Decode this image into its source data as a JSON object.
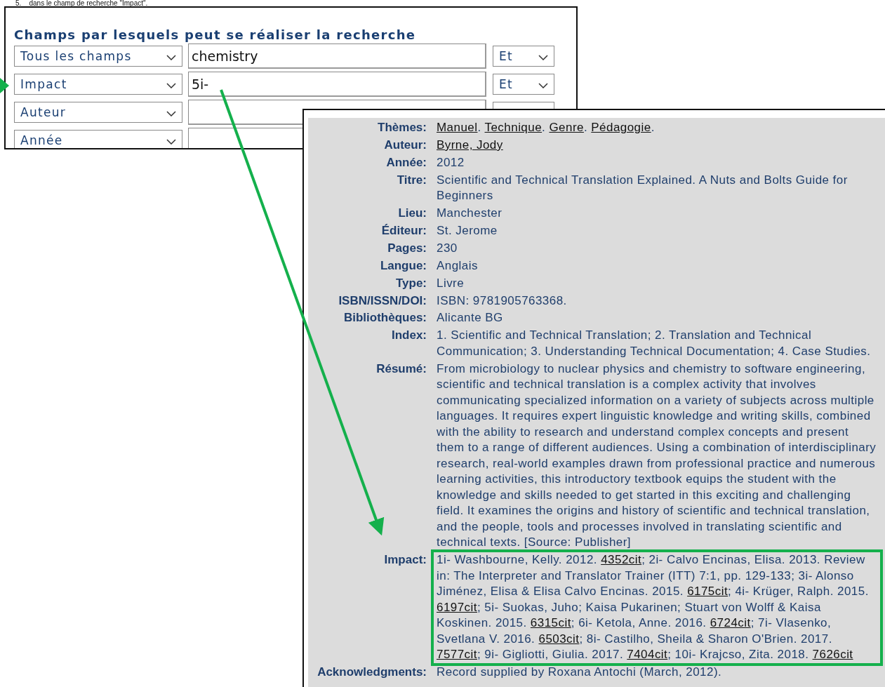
{
  "note": "5.    dans le champ de recherche \"Impact\".",
  "search_panel": {
    "title": "Champs par lesquels peut se réaliser la recherche",
    "rows": [
      {
        "field": "Tous les champs",
        "term": "chemistry",
        "operator": "Et",
        "kind": "full"
      },
      {
        "field": "Impact",
        "term": "5i-",
        "operator": "Et",
        "kind": "full"
      },
      {
        "field": "Auteur",
        "kind": "full"
      },
      {
        "field": "Année",
        "kind": "partial"
      }
    ]
  },
  "record": {
    "fields": [
      {
        "label": "Thèmes:",
        "highlighted": false,
        "segments": [
          {
            "text": "Manuel",
            "kind": "link"
          },
          {
            "text": ". ",
            "kind": "text"
          },
          {
            "text": "Technique",
            "kind": "link"
          },
          {
            "text": ". ",
            "kind": "text"
          },
          {
            "text": "Genre",
            "kind": "link"
          },
          {
            "text": ". ",
            "kind": "text"
          },
          {
            "text": "Pédagogie",
            "kind": "link"
          },
          {
            "text": ".",
            "kind": "text"
          }
        ]
      },
      {
        "label": "Auteur:",
        "highlighted": false,
        "segments": [
          {
            "text": "Byrne, Jody",
            "kind": "link"
          }
        ]
      },
      {
        "label": "Année:",
        "highlighted": false,
        "value": "2012"
      },
      {
        "label": "Titre:",
        "highlighted": false,
        "value": "Scientific and Technical Translation Explained. A Nuts and Bolts Guide for Beginners"
      },
      {
        "label": "Lieu:",
        "highlighted": false,
        "value": "Manchester"
      },
      {
        "label": "Éditeur:",
        "highlighted": false,
        "value": "St. Jerome"
      },
      {
        "label": "Pages:",
        "highlighted": false,
        "value": "230"
      },
      {
        "label": "Langue:",
        "highlighted": false,
        "value": "Anglais"
      },
      {
        "label": "Type:",
        "highlighted": false,
        "value": "Livre"
      },
      {
        "label": "ISBN/ISSN/DOI:",
        "highlighted": false,
        "value": "ISBN: 9781905763368."
      },
      {
        "label": "Bibliothèques:",
        "highlighted": false,
        "value": "Alicante BG"
      },
      {
        "label": "Index:",
        "highlighted": false,
        "value": "1. Scientific and Technical Translation; 2. Translation and Technical Communication; 3. Understanding Technical Documentation; 4. Case Studies."
      },
      {
        "label": "Résumé:",
        "highlighted": false,
        "value": "From microbiology to nuclear physics and chemistry to software engineering, scientific and technical translation is a complex activity that involves communicating specialized information on a variety of subjects across multiple languages. It requires expert linguistic knowledge and writing skills, combined with the ability to research and understand complex concepts and present them to a range of different audiences. Using a combination of interdisciplinary research, real-world examples drawn from professional practice and numerous learning activities, this introductory textbook equips the student with the knowledge and skills needed to get started in this exciting and challenging field. It examines the origins and history of scientific and technical translation, and the people, tools and processes involved in translating scientific and technical texts. [Source: Publisher]"
      },
      {
        "label": "Impact:",
        "highlighted": true,
        "segments": [
          {
            "text": "1i- Washbourne, Kelly. 2012. ",
            "kind": "text"
          },
          {
            "text": "4352cit",
            "kind": "link"
          },
          {
            "text": "; 2i- Calvo Encinas, Elisa. 2013. Review in: The Interpreter and Translator Trainer (ITT) 7:1, pp. 129-133; 3i- Alonso Jiménez, Elisa & Elisa Calvo Encinas. 2015. ",
            "kind": "text"
          },
          {
            "text": "6175cit",
            "kind": "link"
          },
          {
            "text": "; 4i- Krüger, Ralph. 2015. ",
            "kind": "text"
          },
          {
            "text": "6197cit",
            "kind": "link"
          },
          {
            "text": "; 5i- Suokas, Juho; Kaisa Pukarinen; Stuart von Wolff & Kaisa Koskinen. 2015. ",
            "kind": "text"
          },
          {
            "text": "6315cit",
            "kind": "link"
          },
          {
            "text": "; 6i- Ketola, Anne. 2016. ",
            "kind": "text"
          },
          {
            "text": "6724cit",
            "kind": "link"
          },
          {
            "text": "; 7i- Vlasenko, Svetlana V. 2016. ",
            "kind": "text"
          },
          {
            "text": "6503cit",
            "kind": "link"
          },
          {
            "text": "; 8i- Castilho, Sheila & Sharon O'Brien. 2017. ",
            "kind": "text"
          },
          {
            "text": "7577cit",
            "kind": "link"
          },
          {
            "text": "; 9i- Gigliotti, Giulia. 2017. ",
            "kind": "text"
          },
          {
            "text": "7404cit",
            "kind": "link"
          },
          {
            "text": "; 10i- Krajcso, Zita. 2018. ",
            "kind": "text"
          },
          {
            "text": "7626cit",
            "kind": "link"
          }
        ]
      },
      {
        "label": "Acknowledgments:",
        "highlighted": false,
        "value": "Record supplied by Roxana Antochi (March, 2012)."
      }
    ]
  }
}
